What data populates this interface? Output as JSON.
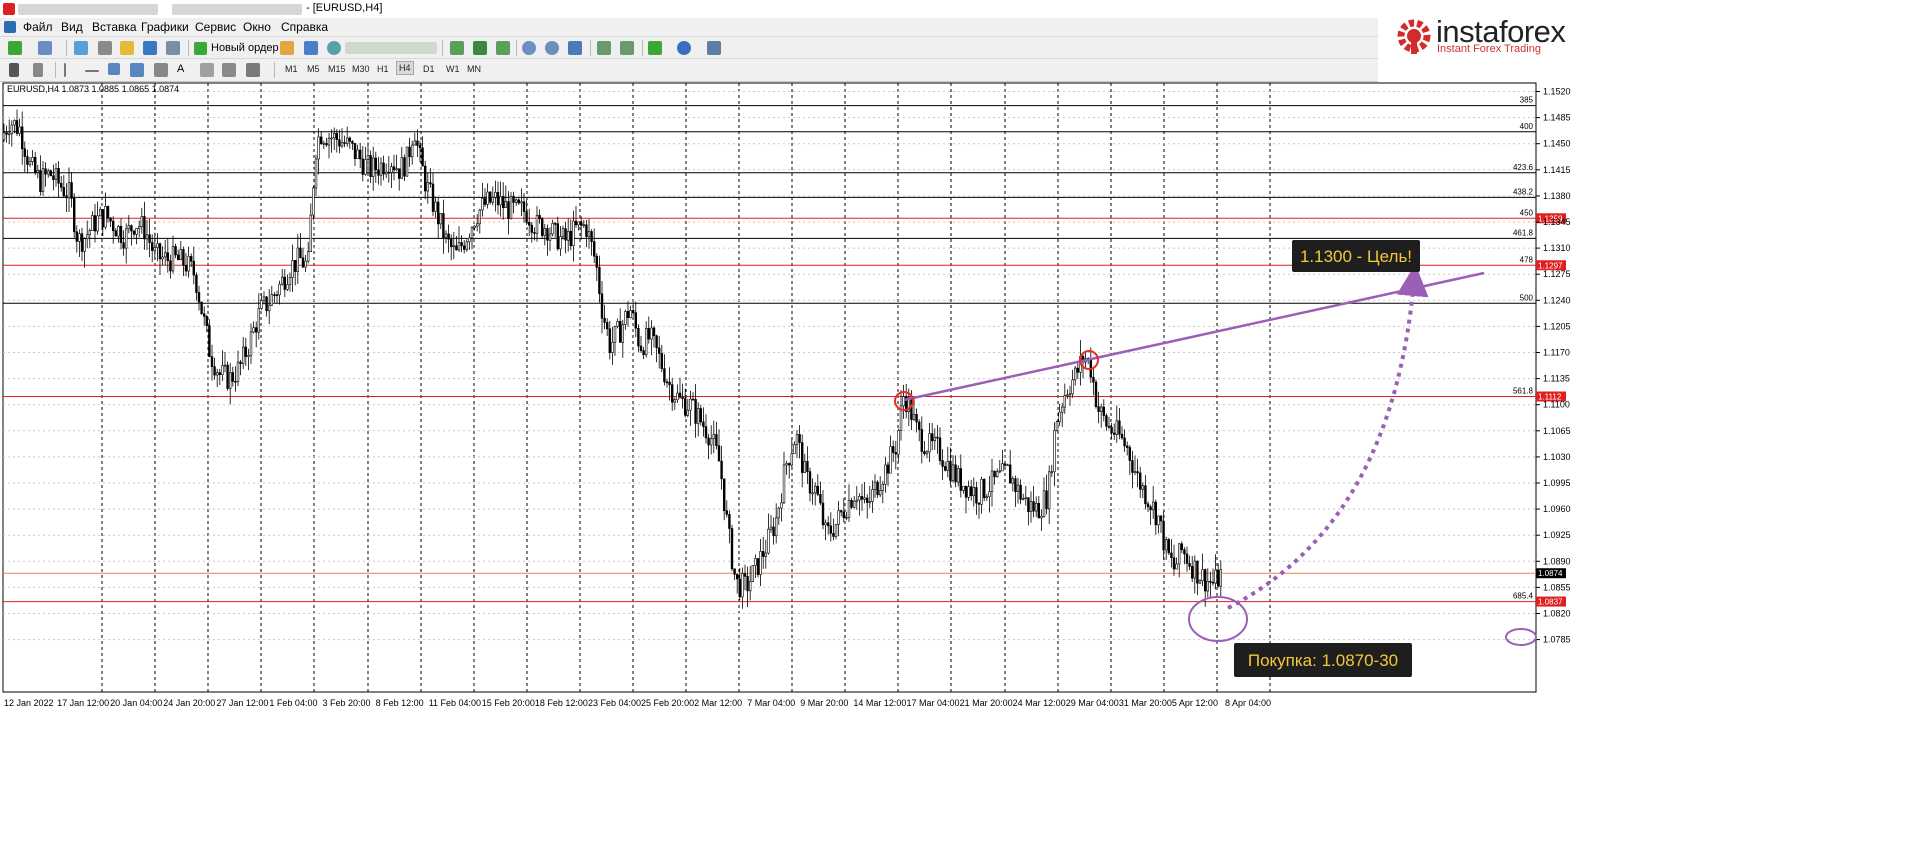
{
  "window": {
    "title": "- [EURUSD,H4]"
  },
  "menu": [
    "Файл",
    "Вид",
    "Вставка",
    "Графики",
    "Сервис",
    "Окно",
    "Справка"
  ],
  "toolbar": {
    "new_order_label": "Новый ордер"
  },
  "timeframes": [
    "M1",
    "M5",
    "M15",
    "M30",
    "H1",
    "H4",
    "D1",
    "W1",
    "MN"
  ],
  "active_timeframe": "H4",
  "logo": {
    "name": "instaforex",
    "subtitle": "Instant Forex Trading"
  },
  "chart_data": {
    "type": "candlestick",
    "symbol_info": "EURUSD,H4  1.0873 1.0885 1.0865 1.0874",
    "ylim": [
      1.0775,
      1.1525
    ],
    "y_ticks": [
      "1.1520",
      "1.1485",
      "1.1450",
      "1.1415",
      "1.1380",
      "1.1345",
      "1.1310",
      "1.1275",
      "1.1240",
      "1.1205",
      "1.1170",
      "1.1135",
      "1.1100",
      "1.1065",
      "1.1030",
      "1.0995",
      "1.0960",
      "1.0925",
      "1.0890",
      "1.0855",
      "1.0820",
      "1.0785"
    ],
    "x_ticks": [
      "12 Jan 2022",
      "17 Jan 12:00",
      "20 Jan 04:00",
      "24 Jan 20:00",
      "27 Jan 12:00",
      "1 Feb 04:00",
      "3 Feb 20:00",
      "8 Feb 12:00",
      "11 Feb 04:00",
      "15 Feb 20:00",
      "18 Feb 12:00",
      "23 Feb 04:00",
      "25 Feb 20:00",
      "2 Mar 12:00",
      "7 Mar 04:00",
      "9 Mar 20:00",
      "14 Mar 12:00",
      "17 Mar 04:00",
      "21 Mar 20:00",
      "24 Mar 12:00",
      "29 Mar 04:00",
      "31 Mar 20:00",
      "5 Apr 12:00",
      "8 Apr 04:00"
    ],
    "close_path": [
      [
        0,
        1.1455
      ],
      [
        10,
        1.148
      ],
      [
        20,
        1.147
      ],
      [
        30,
        1.142
      ],
      [
        40,
        1.14
      ],
      [
        50,
        1.141
      ],
      [
        60,
        1.1395
      ],
      [
        70,
        1.138
      ],
      [
        78,
        1.132
      ],
      [
        85,
        1.1325
      ],
      [
        95,
        1.1345
      ],
      [
        105,
        1.1355
      ],
      [
        115,
        1.134
      ],
      [
        125,
        1.1325
      ],
      [
        135,
        1.1345
      ],
      [
        145,
        1.1335
      ],
      [
        155,
        1.13
      ],
      [
        165,
        1.1295
      ],
      [
        175,
        1.1295
      ],
      [
        185,
        1.129
      ],
      [
        195,
        1.1275
      ],
      [
        202,
        1.1225
      ],
      [
        210,
        1.117
      ],
      [
        220,
        1.114
      ],
      [
        230,
        1.1135
      ],
      [
        240,
        1.115
      ],
      [
        250,
        1.1185
      ],
      [
        260,
        1.1225
      ],
      [
        270,
        1.124
      ],
      [
        280,
        1.126
      ],
      [
        290,
        1.1285
      ],
      [
        300,
        1.1295
      ],
      [
        308,
        1.1285
      ],
      [
        312,
        1.1375
      ],
      [
        316,
        1.1445
      ],
      [
        320,
        1.1465
      ],
      [
        330,
        1.146
      ],
      [
        340,
        1.1455
      ],
      [
        350,
        1.1445
      ],
      [
        360,
        1.143
      ],
      [
        370,
        1.1415
      ],
      [
        380,
        1.142
      ],
      [
        390,
        1.143
      ],
      [
        400,
        1.1415
      ],
      [
        408,
        1.143
      ],
      [
        414,
        1.1475
      ],
      [
        418,
        1.144
      ],
      [
        426,
        1.1395
      ],
      [
        436,
        1.136
      ],
      [
        446,
        1.132
      ],
      [
        456,
        1.13
      ],
      [
        466,
        1.1325
      ],
      [
        476,
        1.1355
      ],
      [
        486,
        1.137
      ],
      [
        496,
        1.1375
      ],
      [
        506,
        1.1365
      ],
      [
        516,
        1.136
      ],
      [
        526,
        1.136
      ],
      [
        536,
        1.134
      ],
      [
        546,
        1.134
      ],
      [
        556,
        1.1325
      ],
      [
        566,
        1.132
      ],
      [
        576,
        1.1335
      ],
      [
        586,
        1.134
      ],
      [
        596,
        1.129
      ],
      [
        602,
        1.123
      ],
      [
        610,
        1.118
      ],
      [
        620,
        1.12
      ],
      [
        630,
        1.123
      ],
      [
        640,
        1.118
      ],
      [
        650,
        1.119
      ],
      [
        660,
        1.116
      ],
      [
        670,
        1.1125
      ],
      [
        680,
        1.1105
      ],
      [
        690,
        1.11
      ],
      [
        700,
        1.108
      ],
      [
        710,
        1.106
      ],
      [
        720,
        1.102
      ],
      [
        728,
        1.093
      ],
      [
        736,
        1.086
      ],
      [
        746,
        1.0855
      ],
      [
        756,
        1.088
      ],
      [
        766,
        1.091
      ],
      [
        776,
        1.0945
      ],
      [
        786,
        1.102
      ],
      [
        796,
        1.106
      ],
      [
        806,
        1.1
      ],
      [
        816,
        1.0985
      ],
      [
        826,
        1.0925
      ],
      [
        836,
        1.094
      ],
      [
        846,
        1.0965
      ],
      [
        856,
        1.0985
      ],
      [
        866,
        1.096
      ],
      [
        876,
        1.099
      ],
      [
        886,
        1.1015
      ],
      [
        896,
        1.1045
      ],
      [
        904,
        1.1115
      ],
      [
        910,
        1.1095
      ],
      [
        918,
        1.106
      ],
      [
        928,
        1.1045
      ],
      [
        938,
        1.104
      ],
      [
        948,
        1.102
      ],
      [
        958,
        1.1
      ],
      [
        968,
        1.099
      ],
      [
        978,
        1.098
      ],
      [
        988,
        1.099
      ],
      [
        998,
        1.1
      ],
      [
        1008,
        1.101
      ],
      [
        1018,
        1.0985
      ],
      [
        1028,
        1.0965
      ],
      [
        1038,
        1.096
      ],
      [
        1048,
        1.098
      ],
      [
        1056,
        1.108
      ],
      [
        1066,
        1.112
      ],
      [
        1076,
        1.114
      ],
      [
        1084,
        1.1165
      ],
      [
        1090,
        1.1155
      ],
      [
        1098,
        1.1095
      ],
      [
        1108,
        1.107
      ],
      [
        1118,
        1.106
      ],
      [
        1128,
        1.104
      ],
      [
        1138,
        1.1
      ],
      [
        1148,
        1.0975
      ],
      [
        1158,
        1.095
      ],
      [
        1166,
        1.0905
      ],
      [
        1174,
        1.088
      ],
      [
        1182,
        1.0905
      ],
      [
        1192,
        1.0885
      ],
      [
        1198,
        1.0875
      ],
      [
        1206,
        1.0865
      ],
      [
        1214,
        1.086
      ],
      [
        1222,
        1.0874
      ]
    ],
    "levels": [
      {
        "label": "385",
        "value": 1.1501,
        "color": "#000000"
      },
      {
        "label": "400",
        "value": 1.1466,
        "color": "#000000"
      },
      {
        "label": "423.6",
        "value": 1.1411,
        "color": "#000000"
      },
      {
        "label": "438.2",
        "value": 1.1378,
        "color": "#000000"
      },
      {
        "label": "450",
        "value": 1.135,
        "color": "#e02020",
        "price_tag": "1.1359"
      },
      {
        "label": "461.8",
        "value": 1.1323,
        "color": "#000000"
      },
      {
        "label": "478",
        "value": 1.1287,
        "color": "#e02020",
        "price_tag": "1.1297"
      },
      {
        "label": "500",
        "value": 1.1236,
        "color": "#000000"
      },
      {
        "label": "561.8",
        "value": 1.1111,
        "color": "#e02020",
        "price_tag": "1.1112"
      },
      {
        "label": "",
        "value": 1.0874,
        "color": "#f08060",
        "price_tag": "1.0874"
      },
      {
        "label": "685.4",
        "value": 1.0836,
        "color": "#e02020",
        "price_tag": "1.0837"
      }
    ],
    "annotations": {
      "target_label": "1.1300 - Цель!",
      "buy_label": "Покупка: 1.0870-30"
    }
  }
}
